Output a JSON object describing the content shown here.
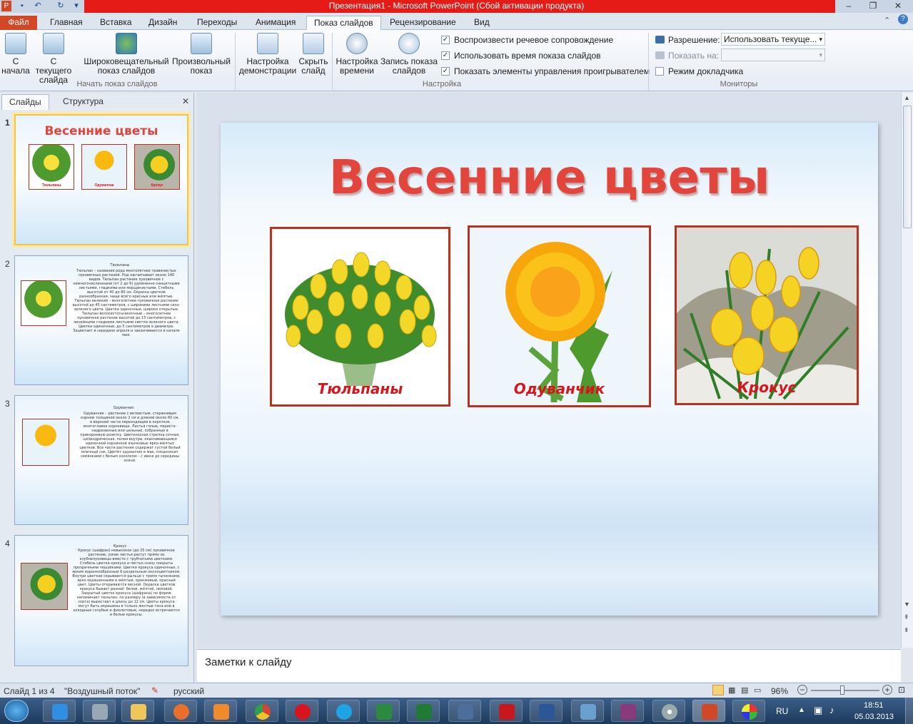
{
  "window": {
    "title": "Презентация1 - Microsoft PowerPoint (Сбой активации продукта)"
  },
  "tabs": [
    "Файл",
    "Главная",
    "Вставка",
    "Дизайн",
    "Переходы",
    "Анимация",
    "Показ слайдов",
    "Рецензирование",
    "Вид"
  ],
  "ribbon": {
    "start_group": {
      "label": "Начать показ слайдов",
      "buttons": [
        "С\nначала",
        "С текущего\nслайда",
        "Широковещательный\nпоказ слайдов",
        "Произвольный\nпоказ"
      ]
    },
    "setup_group": {
      "label": "Настройка",
      "buttons": [
        "Настройка\nдемонстрации",
        "Скрыть\nслайд",
        "Настройка\nвремени",
        "Запись показа\nслайдов"
      ],
      "checks": [
        {
          "label": "Воспроизвести речевое сопровождение",
          "checked": true
        },
        {
          "label": "Использовать время показа слайдов",
          "checked": true
        },
        {
          "label": "Показать элементы управления проигрывателем",
          "checked": true
        }
      ]
    },
    "monitors_group": {
      "label": "Мониторы",
      "resolution_label": "Разрешение:",
      "resolution_value": "Использовать текуще...",
      "show_on_label": "Показать на:",
      "presenter_label": "Режим докладчика"
    }
  },
  "panel": {
    "tab_slides": "Слайды",
    "tab_outline": "Структура",
    "close": "✕"
  },
  "thumbs": [
    {
      "num": "1",
      "title": "Весенние цветы",
      "captions": [
        "Тюльпаны",
        "Одуванчик",
        "Крокус"
      ]
    },
    {
      "num": "2",
      "title": "Тюльпаны",
      "text": "Тюльпан – название рода многолетних травянистых луковичных растений. Род насчитывает около 140 видов. Тюльпан растение луковичное с немногочисленными (от 2 до 6) удлиненно-ланцетными листьями, гладкими или морщинистыми. Стебель высотой от 40 до 80 см. Окраска цветков разнообразная, чаще всего красные или жёлтые. Тюльпан великий – многолетнее луковичное растение высотой до 45 сантиметров, с широкими листьями сизо-зеленого цвета. Цветки одиночные, широко открытые. Тюльпан волосистотычиночный – многолетнее луковичное растение высотой до 15 сантиметров, с линейными гладкими листьями светло-зеленого цвета. Цветки одиночные, до 5 сантиметров в диаметре. Зацветает в середине апреля и заканчивается в начале мая."
    },
    {
      "num": "3",
      "title": "Одуванчик",
      "text": "Одуванчик – растение с ветвистым, стержневым корнем толщиной около 2 см и длиной около 60 см, в верхней части переходящим в короткое многоглавое корневище. Листья голые, перисто-надрезанные или цельные, собранные в прикорневую розетку. Цветоносная стрелка сочная, цилиндрическая, полая внутри, оканчивающаяся одиночной корзинкой язычковых ярко-жёлтых цветков. Все части растения содержат густой белый млечный сок. Цветёт одуванчик в мае, плодоносит семянками с белым хохолком – с июня до середины осени."
    },
    {
      "num": "4",
      "title": "Крокус",
      "text": "Крокус (шафран) невысокое (до 25 см) луковичное растение, узкие листья растут прямо из клубнелуковицы вместе с трубчатыми цветками. Стебель цветка крокуса и листья снизу покрыты прозрачными чешуйками. Цветки крокуса одиночные, с ярким воронкообразным 6-раздельным околоцветником. Внутри цветков скрываются рыльце с тремя тычинками, ярко окрашенными в жёлтый, оранжевый, красный цвет. Цветы открываются весной. Окраска цветков крокуса бывает разной: белой, жёлтой, лиловой. Закрытый цветок крокуса (шафрана) по форме напоминает тюльпан, по размеру (в зависимости от сорта) вырастает в длину до 12 см. Цветы крокуса могут быть окрашены в только желтые тона или в холодные голубые и фиолетовые, нередко встречаются и белые крокусы."
    }
  ],
  "slide": {
    "title": "Весенние цветы",
    "cards": [
      {
        "caption": "Тюльпаны"
      },
      {
        "caption": "Одуванчик"
      },
      {
        "caption": "Крокус"
      }
    ]
  },
  "notes": {
    "placeholder": "Заметки к слайду"
  },
  "status": {
    "slide": "Слайд 1 из 4",
    "theme": "\"Воздушный поток\"",
    "language": "русский",
    "zoom": "96%"
  },
  "tray": {
    "lang": "RU",
    "time": "18:51",
    "date": "05.03.2013"
  },
  "colors": {
    "accent": "#e41b17",
    "title_red": "#e2453b",
    "frame": "#b7321f"
  }
}
